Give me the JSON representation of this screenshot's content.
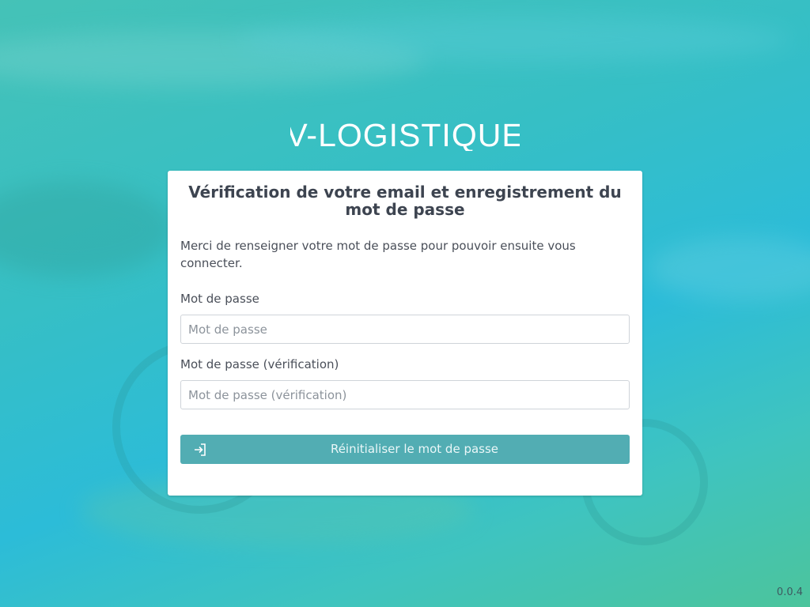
{
  "brand": {
    "name": "V-LOGISTIQUE"
  },
  "form": {
    "title": "Vérification de votre email et enregistrement du mot de passe",
    "description": "Merci de renseigner votre mot de passe pour pouvoir ensuite vous connecter.",
    "password": {
      "label": "Mot de passe",
      "placeholder": "Mot de passe",
      "value": ""
    },
    "password_confirm": {
      "label": "Mot de passe (vérification)",
      "placeholder": "Mot de passe (vérification)",
      "value": ""
    },
    "submit": {
      "label": "Réinitialiser le mot de passe",
      "icon": "sign-in-icon"
    }
  },
  "footer": {
    "version": "0.0.4"
  },
  "colors": {
    "button_bg": "#52adb3",
    "title_text": "#3d4450",
    "background_accent": "#2cbcd8"
  }
}
